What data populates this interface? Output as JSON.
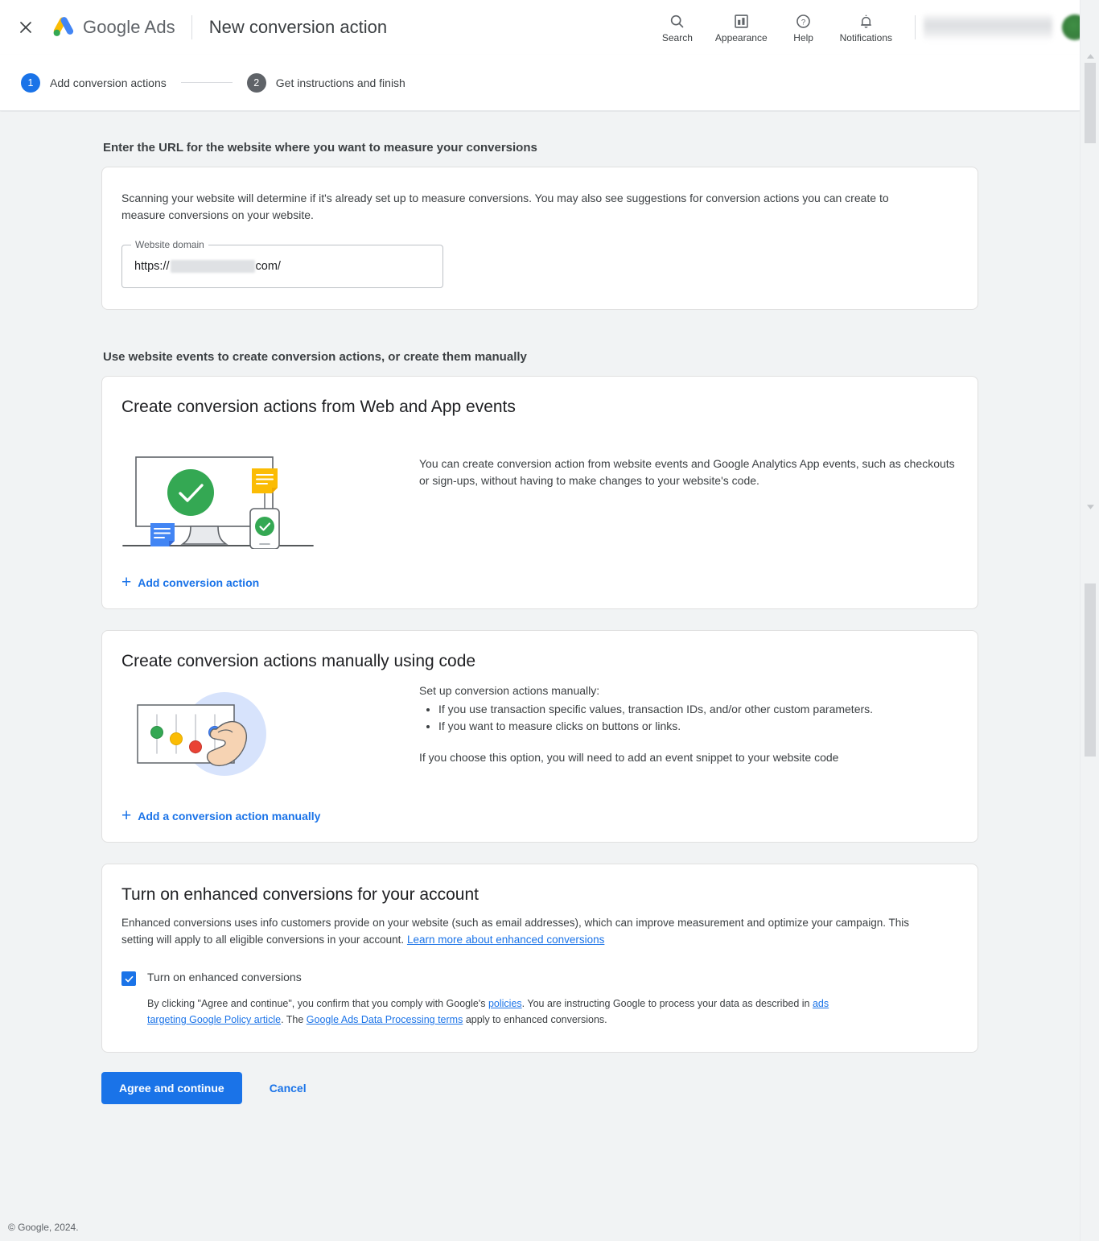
{
  "topbar": {
    "close_icon": "close-icon",
    "brand": "Google Ads",
    "title": "New conversion action",
    "items": [
      {
        "icon": "search-icon",
        "label": "Search"
      },
      {
        "icon": "appearance-icon",
        "label": "Appearance"
      },
      {
        "icon": "help-icon",
        "label": "Help"
      },
      {
        "icon": "notifications-icon",
        "label": "Notifications"
      }
    ]
  },
  "stepper": {
    "steps": [
      {
        "num": "1",
        "label": "Add conversion actions",
        "state": "active"
      },
      {
        "num": "2",
        "label": "Get instructions and finish",
        "state": "inactive"
      }
    ]
  },
  "url_section": {
    "heading": "Enter the URL for the website where you want to measure your conversions",
    "description": "Scanning your website will determine if it's already set up to measure conversions. You may also see suggestions for conversion actions you can create to measure conversions on your website.",
    "field_label": "Website domain",
    "value_prefix": "https://",
    "value_suffix": "com/",
    "value_redacted": true
  },
  "events_section": {
    "heading": "Use website events to create conversion actions, or create them manually",
    "web_app_card": {
      "title": "Create conversion actions from Web and App events",
      "illustration": "monitor-check-illustration",
      "body": "You can create conversion action from website events and Google Analytics App events, such as checkouts or sign-ups, without having to make changes to your website's code.",
      "add_link": "Add conversion action"
    },
    "manual_card": {
      "title": "Create conversion actions manually using code",
      "illustration": "sliders-hand-illustration",
      "intro": "Set up conversion actions manually:",
      "bullets": [
        "If you use transaction specific values, transaction IDs, and/or other custom parameters.",
        "If you want to measure clicks on buttons or links."
      ],
      "outro": "If you choose this option, you will need to add an event snippet to your website code",
      "add_link": "Add a conversion action manually"
    }
  },
  "enhanced_section": {
    "title": "Turn on enhanced conversions for your account",
    "desc_part1": "Enhanced conversions uses info customers provide on your website (such as email addresses), which can improve measurement and optimize your campaign. This setting will apply to all eligible conversions in your account. ",
    "desc_link": "Learn more about enhanced conversions",
    "checkbox_label": "Turn on enhanced conversions",
    "checkbox_checked": true,
    "legal_1": "By clicking \"Agree and continue\", you confirm that you comply with Google's ",
    "legal_link_1": "policies",
    "legal_2": ". You are instructing Google to process your data as described in ",
    "legal_link_2": "ads targeting Google Policy article",
    "legal_3": ". The ",
    "legal_link_3": "Google Ads Data Processing terms",
    "legal_4": " apply to enhanced conversions."
  },
  "actions": {
    "primary": "Agree and continue",
    "secondary": "Cancel"
  },
  "footer": {
    "copyright": "© Google, 2024."
  },
  "colors": {
    "accent_blue": "#1a73e8",
    "bg_gray": "#f1f3f4",
    "text_primary": "#202124",
    "text_secondary": "#3c4043",
    "green": "#34a853",
    "yellow": "#fbbc04",
    "red": "#ea4335"
  }
}
